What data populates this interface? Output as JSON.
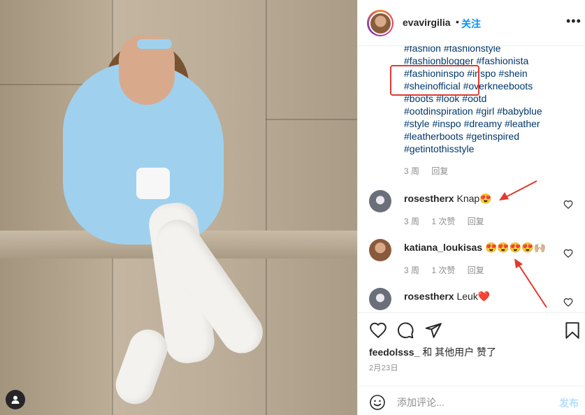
{
  "post": {
    "username": "evavirgilia",
    "dot": "•",
    "follow_label": "关注",
    "more_label": "•••",
    "photo_alt": "Woman in light blue dress and white over-knee boots"
  },
  "caption": {
    "hashtags": [
      "#fashion #fashionstyle",
      "#fashionblogger #fashionista",
      "#fashioninspo #inspo #shein",
      "#sheinofficial #overkneeboots",
      "#boots #look #ootd",
      "#ootdinspiration #girl #babyblue",
      "#style #inspo #dreamy #leather",
      "#leatherboots #getinspired",
      "#getintothisstyle"
    ],
    "time": "3 周",
    "reply_label": "回复"
  },
  "comments": [
    {
      "username": "rosestherx",
      "text": "Knap😍",
      "time": "3 周",
      "likes": "1 次赞",
      "reply_label": "回复",
      "avatar_color": "#6b6f7a"
    },
    {
      "username": "katiana_loukisas",
      "text": "😍😍😍😍🙌🏼",
      "time": "3 周",
      "likes": "1 次赞",
      "reply_label": "回复",
      "avatar_color": "#8a5a3c"
    },
    {
      "username": "rosestherx",
      "text": "Leuk❤️",
      "avatar_color": "#6b6f7a"
    }
  ],
  "actions": {
    "liked_by_user": "feedolsss_",
    "liked_by_rest": " 和 其他用户 赞了",
    "date": "2月23日"
  },
  "add_comment": {
    "placeholder": "添加评论...",
    "post_label": "发布"
  },
  "colors": {
    "link": "#00376b",
    "follow": "#0095f6",
    "post_disabled": "#b2dffc",
    "annotation": "#e03a2f"
  },
  "icons": [
    "heart-icon",
    "comment-icon",
    "share-icon",
    "bookmark-icon",
    "emoji-icon",
    "more-icon",
    "user-tag-icon"
  ]
}
